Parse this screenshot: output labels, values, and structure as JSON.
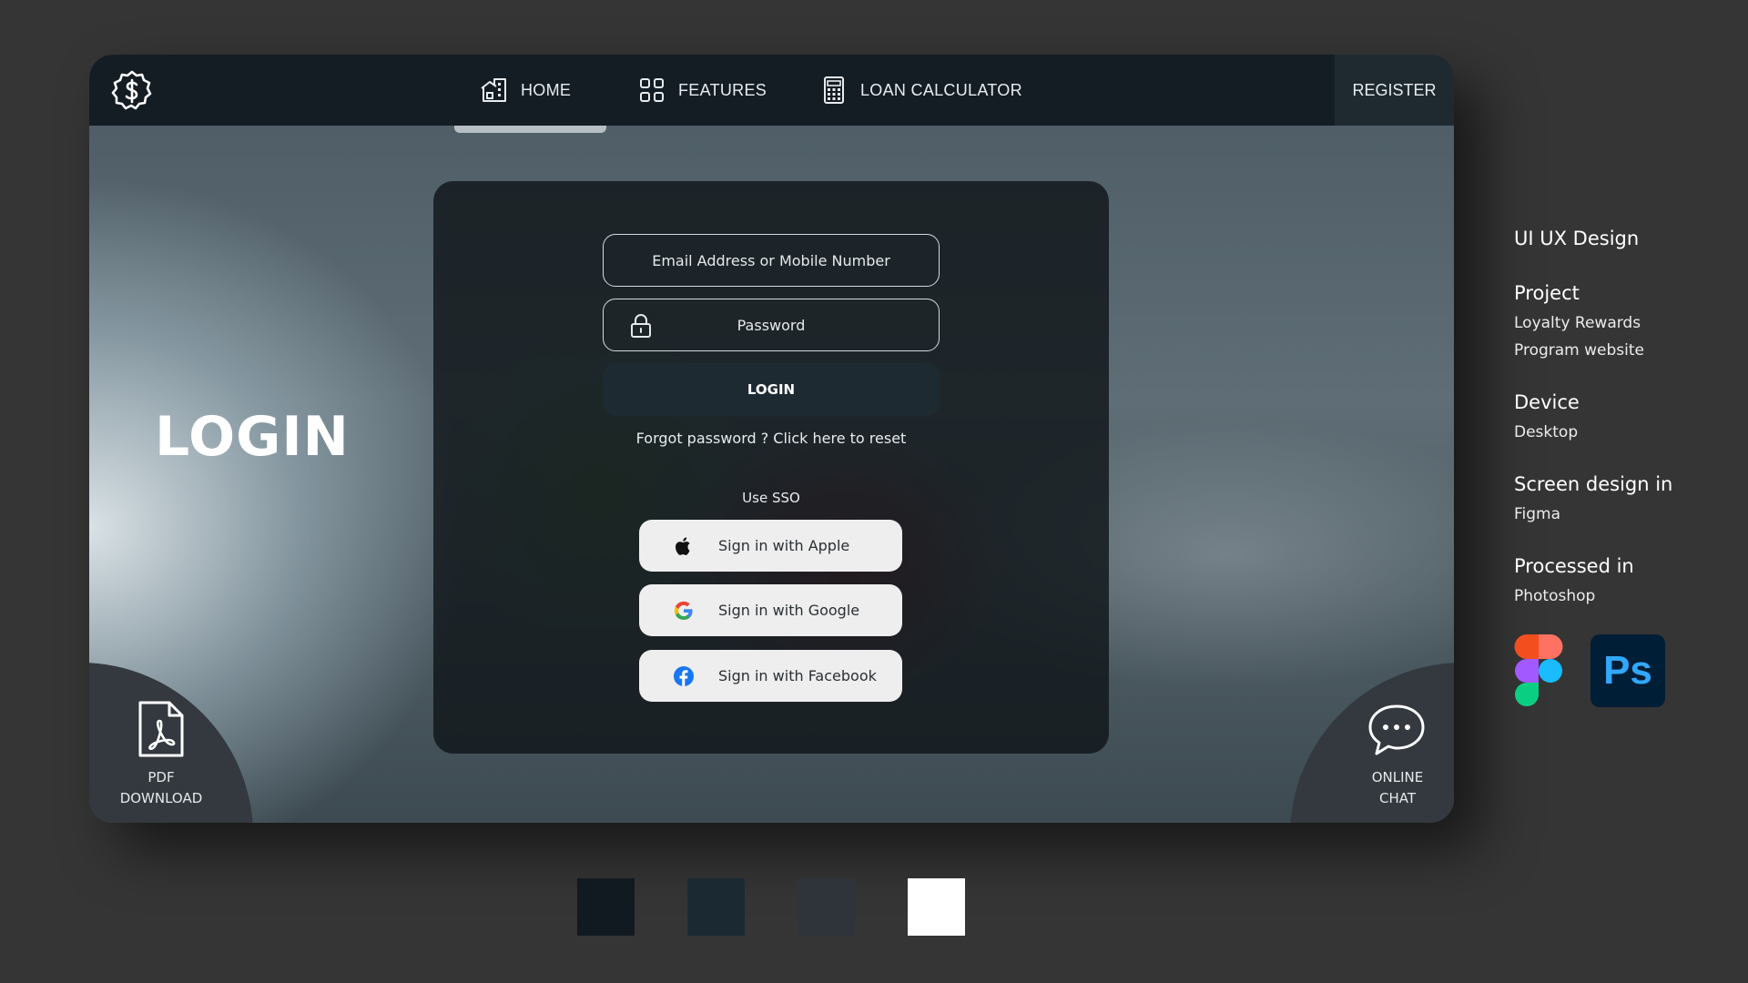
{
  "nav": {
    "home": "HOME",
    "features": "FEATURES",
    "loan_calculator": "LOAN CALCULATOR",
    "register": "REGISTER"
  },
  "page": {
    "title": "LOGIN"
  },
  "form": {
    "email_placeholder": "Email Address or Mobile Number",
    "password_placeholder": "Password",
    "login_label": "LOGIN",
    "forgot": "Forgot password ? Click here to reset",
    "sso_label": "Use SSO",
    "sso": {
      "apple": "Sign in with Apple",
      "google": "Sign in with Google",
      "facebook": "Sign in with Facebook"
    }
  },
  "corners": {
    "pdf": [
      "PDF",
      "DOWNLOAD"
    ],
    "chat": [
      "ONLINE",
      "CHAT"
    ]
  },
  "info": {
    "heading": "UI UX Design",
    "project_title": "Project",
    "project_lines": [
      "Loyalty Rewards",
      "Program website"
    ],
    "device_title": "Device",
    "device_value": "Desktop",
    "screen_title": "Screen design in",
    "screen_value": "Figma",
    "processed_title": "Processed in",
    "processed_value": "Photoshop",
    "ps_logo_text": "Ps"
  },
  "palette": [
    "#111a20",
    "#1b2a32",
    "#2e3439",
    "#ffffff"
  ],
  "icons": [
    "dollar-badge-icon",
    "home-icon",
    "grid-icon",
    "calculator-icon",
    "lock-icon",
    "apple-icon",
    "google-icon",
    "facebook-icon",
    "pdf-file-icon",
    "chat-bubble-icon",
    "figma-logo",
    "photoshop-logo"
  ]
}
